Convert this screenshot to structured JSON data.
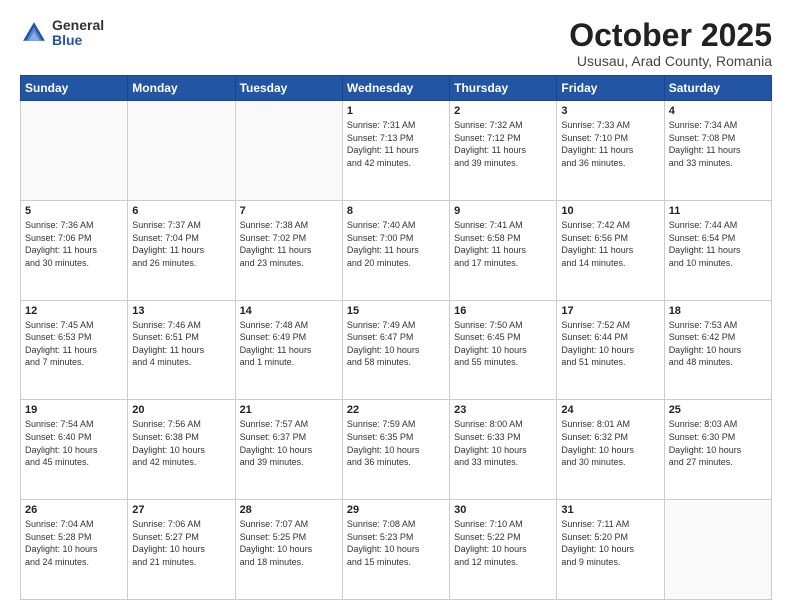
{
  "header": {
    "logo_general": "General",
    "logo_blue": "Blue",
    "month_title": "October 2025",
    "subtitle": "Ususau, Arad County, Romania"
  },
  "weekdays": [
    "Sunday",
    "Monday",
    "Tuesday",
    "Wednesday",
    "Thursday",
    "Friday",
    "Saturday"
  ],
  "weeks": [
    [
      {
        "day": "",
        "info": ""
      },
      {
        "day": "",
        "info": ""
      },
      {
        "day": "",
        "info": ""
      },
      {
        "day": "1",
        "info": "Sunrise: 7:31 AM\nSunset: 7:13 PM\nDaylight: 11 hours\nand 42 minutes."
      },
      {
        "day": "2",
        "info": "Sunrise: 7:32 AM\nSunset: 7:12 PM\nDaylight: 11 hours\nand 39 minutes."
      },
      {
        "day": "3",
        "info": "Sunrise: 7:33 AM\nSunset: 7:10 PM\nDaylight: 11 hours\nand 36 minutes."
      },
      {
        "day": "4",
        "info": "Sunrise: 7:34 AM\nSunset: 7:08 PM\nDaylight: 11 hours\nand 33 minutes."
      }
    ],
    [
      {
        "day": "5",
        "info": "Sunrise: 7:36 AM\nSunset: 7:06 PM\nDaylight: 11 hours\nand 30 minutes."
      },
      {
        "day": "6",
        "info": "Sunrise: 7:37 AM\nSunset: 7:04 PM\nDaylight: 11 hours\nand 26 minutes."
      },
      {
        "day": "7",
        "info": "Sunrise: 7:38 AM\nSunset: 7:02 PM\nDaylight: 11 hours\nand 23 minutes."
      },
      {
        "day": "8",
        "info": "Sunrise: 7:40 AM\nSunset: 7:00 PM\nDaylight: 11 hours\nand 20 minutes."
      },
      {
        "day": "9",
        "info": "Sunrise: 7:41 AM\nSunset: 6:58 PM\nDaylight: 11 hours\nand 17 minutes."
      },
      {
        "day": "10",
        "info": "Sunrise: 7:42 AM\nSunset: 6:56 PM\nDaylight: 11 hours\nand 14 minutes."
      },
      {
        "day": "11",
        "info": "Sunrise: 7:44 AM\nSunset: 6:54 PM\nDaylight: 11 hours\nand 10 minutes."
      }
    ],
    [
      {
        "day": "12",
        "info": "Sunrise: 7:45 AM\nSunset: 6:53 PM\nDaylight: 11 hours\nand 7 minutes."
      },
      {
        "day": "13",
        "info": "Sunrise: 7:46 AM\nSunset: 6:51 PM\nDaylight: 11 hours\nand 4 minutes."
      },
      {
        "day": "14",
        "info": "Sunrise: 7:48 AM\nSunset: 6:49 PM\nDaylight: 11 hours\nand 1 minute."
      },
      {
        "day": "15",
        "info": "Sunrise: 7:49 AM\nSunset: 6:47 PM\nDaylight: 10 hours\nand 58 minutes."
      },
      {
        "day": "16",
        "info": "Sunrise: 7:50 AM\nSunset: 6:45 PM\nDaylight: 10 hours\nand 55 minutes."
      },
      {
        "day": "17",
        "info": "Sunrise: 7:52 AM\nSunset: 6:44 PM\nDaylight: 10 hours\nand 51 minutes."
      },
      {
        "day": "18",
        "info": "Sunrise: 7:53 AM\nSunset: 6:42 PM\nDaylight: 10 hours\nand 48 minutes."
      }
    ],
    [
      {
        "day": "19",
        "info": "Sunrise: 7:54 AM\nSunset: 6:40 PM\nDaylight: 10 hours\nand 45 minutes."
      },
      {
        "day": "20",
        "info": "Sunrise: 7:56 AM\nSunset: 6:38 PM\nDaylight: 10 hours\nand 42 minutes."
      },
      {
        "day": "21",
        "info": "Sunrise: 7:57 AM\nSunset: 6:37 PM\nDaylight: 10 hours\nand 39 minutes."
      },
      {
        "day": "22",
        "info": "Sunrise: 7:59 AM\nSunset: 6:35 PM\nDaylight: 10 hours\nand 36 minutes."
      },
      {
        "day": "23",
        "info": "Sunrise: 8:00 AM\nSunset: 6:33 PM\nDaylight: 10 hours\nand 33 minutes."
      },
      {
        "day": "24",
        "info": "Sunrise: 8:01 AM\nSunset: 6:32 PM\nDaylight: 10 hours\nand 30 minutes."
      },
      {
        "day": "25",
        "info": "Sunrise: 8:03 AM\nSunset: 6:30 PM\nDaylight: 10 hours\nand 27 minutes."
      }
    ],
    [
      {
        "day": "26",
        "info": "Sunrise: 7:04 AM\nSunset: 5:28 PM\nDaylight: 10 hours\nand 24 minutes."
      },
      {
        "day": "27",
        "info": "Sunrise: 7:06 AM\nSunset: 5:27 PM\nDaylight: 10 hours\nand 21 minutes."
      },
      {
        "day": "28",
        "info": "Sunrise: 7:07 AM\nSunset: 5:25 PM\nDaylight: 10 hours\nand 18 minutes."
      },
      {
        "day": "29",
        "info": "Sunrise: 7:08 AM\nSunset: 5:23 PM\nDaylight: 10 hours\nand 15 minutes."
      },
      {
        "day": "30",
        "info": "Sunrise: 7:10 AM\nSunset: 5:22 PM\nDaylight: 10 hours\nand 12 minutes."
      },
      {
        "day": "31",
        "info": "Sunrise: 7:11 AM\nSunset: 5:20 PM\nDaylight: 10 hours\nand 9 minutes."
      },
      {
        "day": "",
        "info": ""
      }
    ]
  ]
}
